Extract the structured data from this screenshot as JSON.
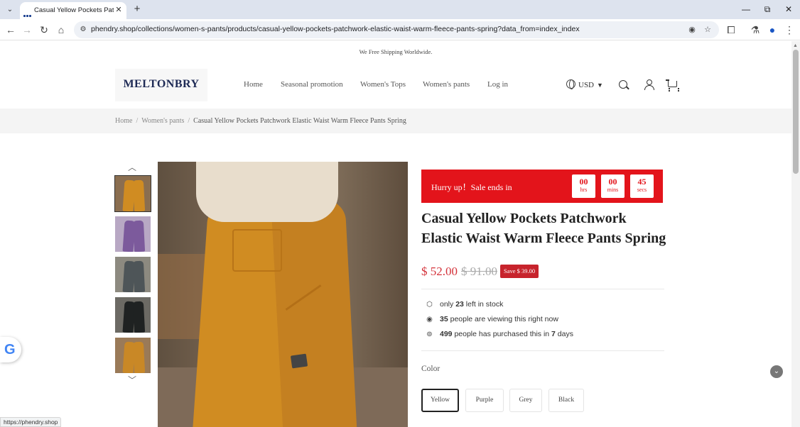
{
  "browser": {
    "tab_title": "Casual Yellow Pockets Patchwork",
    "url": "phendry.shop/collections/women-s-pants/products/casual-yellow-pockets-patchwork-elastic-waist-warm-fleece-pants-spring?data_from=index_index",
    "status_url": "https://phendry.shop",
    "icons": [
      "tab-search-icon",
      "favicon-icon",
      "close-tab-icon",
      "new-tab-icon",
      "minimize-icon",
      "restore-icon",
      "close-window-icon",
      "back-icon",
      "forward-icon",
      "reload-icon",
      "home-icon",
      "site-info-icon",
      "eye-off-icon",
      "star-icon",
      "extensions-icon",
      "labs-icon",
      "profile-icon",
      "menu-icon"
    ]
  },
  "store": {
    "announcement": "We Free Shipping Worldwide.",
    "logo": "MELTONBRY",
    "nav": [
      "Home",
      "Seasonal promotion",
      "Women's Tops",
      "Women's pants",
      "Log in"
    ],
    "currency": "USD"
  },
  "breadcrumb": {
    "items": [
      "Home",
      "Women's pants"
    ],
    "current": "Casual Yellow Pockets Patchwork Elastic Waist Warm Fleece Pants Spring",
    "separator": "/"
  },
  "gallery": {
    "thumbnails": [
      {
        "color": "yellow",
        "bg": "#8a6e50",
        "fill": "#d08c22"
      },
      {
        "color": "purple",
        "bg": "#b8a8c4",
        "fill": "#7c5a9c"
      },
      {
        "color": "grey",
        "bg": "#8d8a80",
        "fill": "#4e5558"
      },
      {
        "color": "black",
        "bg": "#6c6a64",
        "fill": "#1f2222"
      },
      {
        "color": "yellow",
        "bg": "#9a7a58",
        "fill": "#c98826"
      }
    ]
  },
  "countdown": {
    "label": "Hurry up！Sale ends in",
    "units": [
      {
        "value": "00",
        "unit": "hrs"
      },
      {
        "value": "00",
        "unit": "mins"
      },
      {
        "value": "45",
        "unit": "secs"
      }
    ],
    "color": "#e3141b"
  },
  "product": {
    "title": "Casual Yellow Pockets Patchwork Elastic Waist Warm Fleece Pants Spring",
    "price": "$ 52.00",
    "original_price": "$ 91.00",
    "save_badge": "Save $ 39.00",
    "stock": {
      "pre": "only ",
      "num": "23",
      "post": " left in stock"
    },
    "viewing": {
      "num": "35",
      "post": " people are viewing this right now"
    },
    "purchased": {
      "num": "499",
      "mid": " people has purchased this in ",
      "num2": "7",
      "post": " days"
    },
    "color_label": "Color",
    "colors": [
      "Yellow",
      "Purple",
      "Grey",
      "Black"
    ],
    "selected_color": "Yellow"
  },
  "widgets": {
    "google_badge": "G"
  }
}
